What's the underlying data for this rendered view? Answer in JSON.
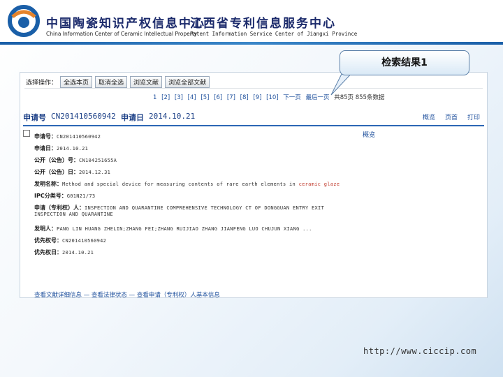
{
  "header": {
    "center1_cn": "中国陶瓷知识产权信息中心",
    "center1_en": "China Information Center of Ceramic Intellectual Property",
    "center2_cn": "江西省专利信息服务中心",
    "center2_en": "Patent Information Service Center of  Jiangxi  Province"
  },
  "callout": {
    "text": "检索结果1"
  },
  "toolbar": {
    "label": "选择操作：",
    "buttons": [
      "全选本页",
      "取消全选",
      "浏览文献",
      "浏览全部文献"
    ]
  },
  "pager": {
    "pages": [
      "1",
      "[2]",
      "[3]",
      "[4]",
      "[5]",
      "[6]",
      "[7]",
      "[8]",
      "[9]",
      "[10]"
    ],
    "next": "下一页",
    "last": "最后一页",
    "total": "共85页 855条数据"
  },
  "result": {
    "app_no_label": "申请号",
    "app_no": "CN201410560942",
    "app_date_label": "申请日",
    "app_date": "2014.10.21",
    "actions": [
      "概览",
      "页首",
      "打印"
    ],
    "detail_link": "概览",
    "fields": [
      {
        "label": "申请号：",
        "value": "CN201410560942"
      },
      {
        "label": "申请日：",
        "value": "2014.10.21"
      },
      {
        "label": "公开（公告）号：",
        "value": "CN104251655A"
      },
      {
        "label": "公开（公告）日：",
        "value": "2014.12.31"
      },
      {
        "label": "发明名称：",
        "value": "Method and special device for measuring contents of rare earth elements in ",
        "highlight": "ceramic glaze"
      },
      {
        "label": "IPC分类号：",
        "value": "G01N21/73"
      },
      {
        "label": "申请（专利权）人：",
        "value": "INSPECTION AND QUARANTINE COMPREHENSIVE TECHNOLOGY CT OF DONGGUAN ENTRY EXIT",
        "cont": "INSPECTION AND QUARANTINE"
      },
      {
        "label": "发明人：",
        "value": "PANG LIN HUANG ZHELIN;ZHANG FEI;ZHANG RUIJIAO ZHANG JIANFENG LUO CHUJUN XIANG ..."
      },
      {
        "label": "优先权号：",
        "value": "CN201410560942"
      },
      {
        "label": "优先权日：",
        "value": "2014.10.21"
      }
    ],
    "footer_links": [
      "查看文献详细信息",
      "查看法律状态",
      "查看申请（专利权）人基本信息"
    ],
    "footer_sep": "—"
  },
  "url": "http://www.ciccip.com",
  "colors": {
    "accent": "#1b3f86",
    "link": "#1d4f9c",
    "header_rule": "#2c67b5"
  }
}
